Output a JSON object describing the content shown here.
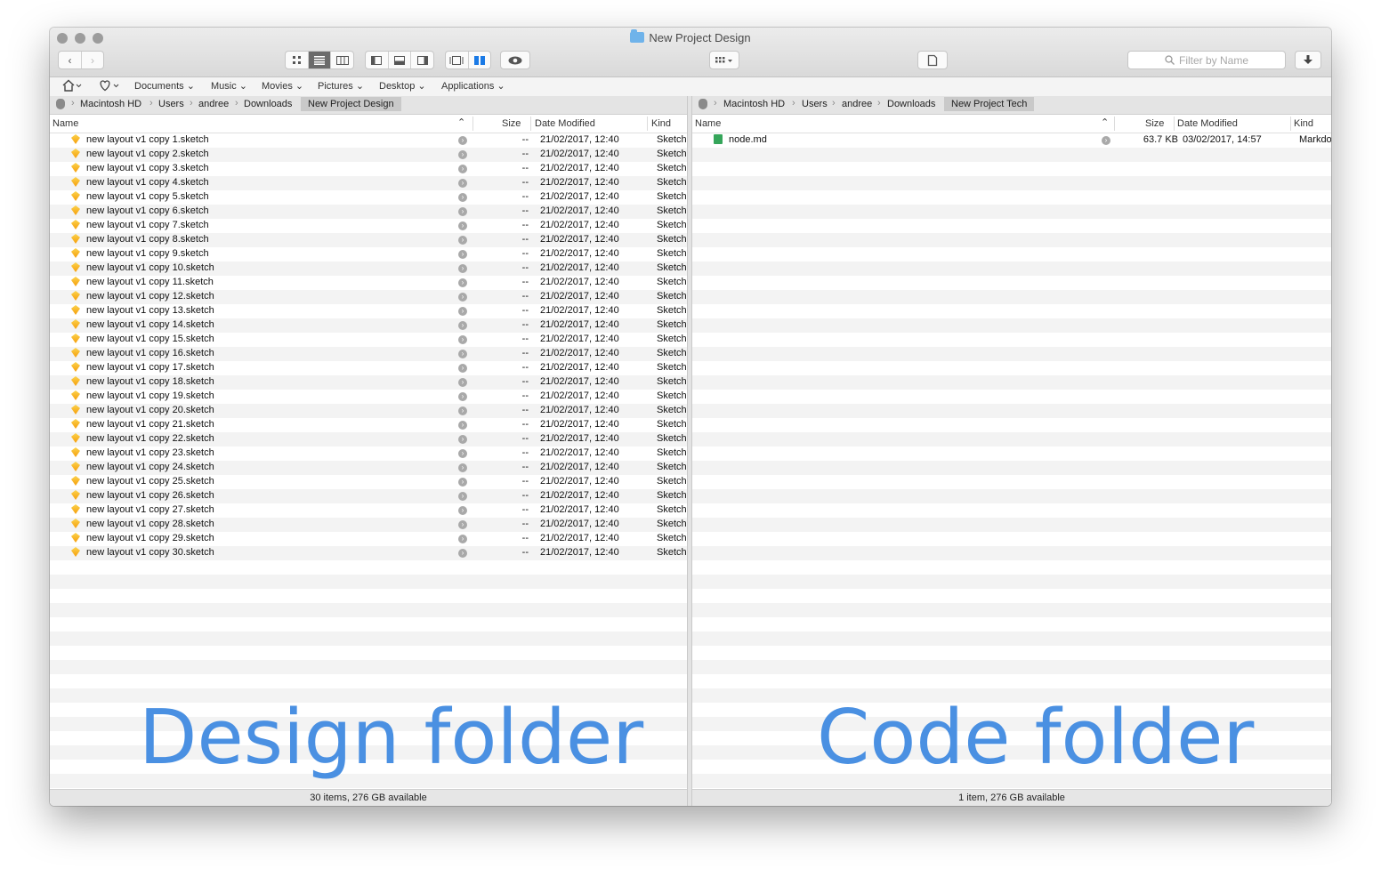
{
  "window": {
    "title": "New Project Design"
  },
  "toolbar": {
    "back_glyph": "‹",
    "forward_glyph": "›",
    "view_buttons": [
      "icon-view",
      "list-view",
      "column-view"
    ],
    "layout_buttons": [
      "left-panel",
      "bottom-panel",
      "right-panel"
    ],
    "mode_buttons": [
      "single-pane",
      "dual-pane"
    ],
    "search_placeholder": "Filter by Name"
  },
  "favorites": [
    {
      "label": "Documents"
    },
    {
      "label": "Music"
    },
    {
      "label": "Movies"
    },
    {
      "label": "Pictures"
    },
    {
      "label": "Desktop"
    },
    {
      "label": "Applications"
    }
  ],
  "left_pane": {
    "path": [
      "Macintosh HD",
      "Users",
      "andree",
      "Downloads"
    ],
    "current": "New Project Design",
    "columns": {
      "name": "Name",
      "size": "Size",
      "date": "Date Modified",
      "kind": "Kind"
    },
    "size_value": "--",
    "date_value": "21/02/2017, 12:40",
    "kind_value": "Sketch",
    "files": [
      "new layout v1 copy 1.sketch",
      "new layout v1 copy 2.sketch",
      "new layout v1 copy 3.sketch",
      "new layout v1 copy 4.sketch",
      "new layout v1 copy 5.sketch",
      "new layout v1 copy 6.sketch",
      "new layout v1 copy 7.sketch",
      "new layout v1 copy 8.sketch",
      "new layout v1 copy 9.sketch",
      "new layout v1 copy 10.sketch",
      "new layout v1 copy 11.sketch",
      "new layout v1 copy 12.sketch",
      "new layout v1 copy 13.sketch",
      "new layout v1 copy 14.sketch",
      "new layout v1 copy 15.sketch",
      "new layout v1 copy 16.sketch",
      "new layout v1 copy 17.sketch",
      "new layout v1 copy 18.sketch",
      "new layout v1 copy 19.sketch",
      "new layout v1 copy 20.sketch",
      "new layout v1 copy 21.sketch",
      "new layout v1 copy 22.sketch",
      "new layout v1 copy 23.sketch",
      "new layout v1 copy 24.sketch",
      "new layout v1 copy 25.sketch",
      "new layout v1 copy 26.sketch",
      "new layout v1 copy 27.sketch",
      "new layout v1 copy 28.sketch",
      "new layout v1 copy 29.sketch",
      "new layout v1 copy 30.sketch"
    ],
    "status": "30 items, 276 GB available",
    "overlay": "Design folder"
  },
  "right_pane": {
    "path": [
      "Macintosh HD",
      "Users",
      "andree",
      "Downloads"
    ],
    "current": "New Project Tech",
    "columns": {
      "name": "Name",
      "size": "Size",
      "date": "Date Modified",
      "kind": "Kind"
    },
    "files": [
      {
        "name": "node.md",
        "size": "63.7 KB",
        "date": "03/02/2017, 14:57",
        "kind": "Markdo"
      }
    ],
    "status": "1 item, 276 GB available",
    "overlay": "Code folder"
  },
  "colors": {
    "accent": "#4a90e2",
    "stripe": "#f3f3f3",
    "sketch_icon": "#f59e0b",
    "md_icon": "#35a55a"
  }
}
